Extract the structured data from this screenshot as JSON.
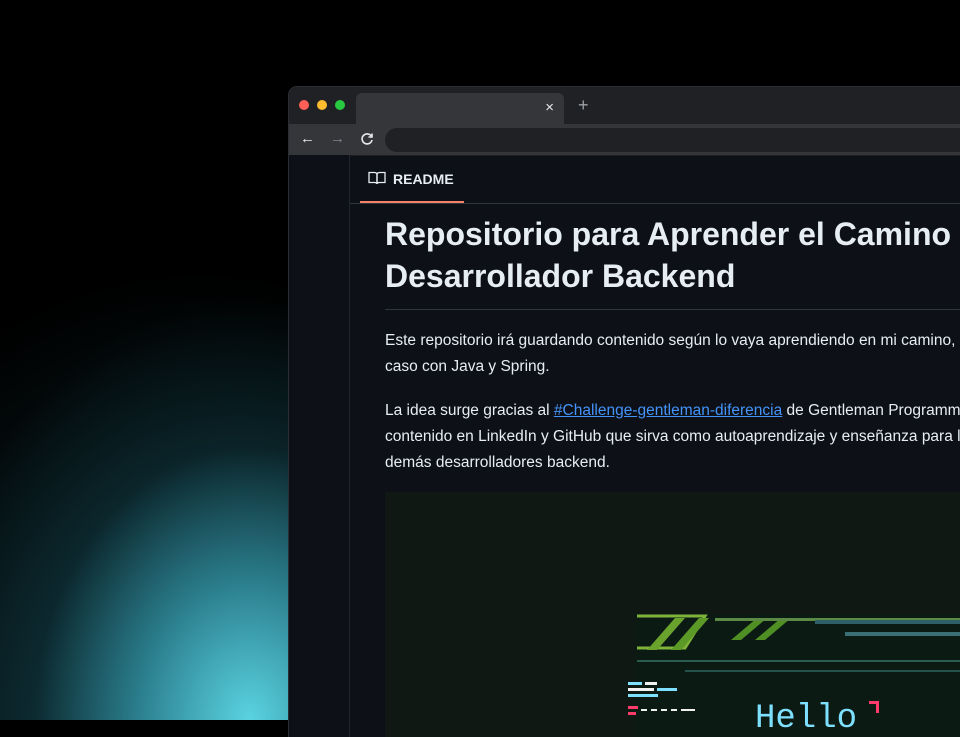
{
  "browser": {
    "tab_close": "×",
    "new_tab": "+",
    "back": "←",
    "forward": "→",
    "reload": "C"
  },
  "readme_tab": {
    "label": "README",
    "icon": "book-icon"
  },
  "article": {
    "title_line1": "Repositorio para Aprender el Camino de",
    "title_line2": "Desarrollador Backend",
    "para1_line1": "Este repositorio irá guardando contenido según lo vaya aprendiendo en mi camino, en este",
    "para1_line2": "caso con Java y Spring.",
    "para2_prefix": "La idea surge gracias al ",
    "para2_link": "#Challenge-gentleman-diferencia",
    "para2_suffix": " de Gentleman Programming, para generar",
    "para2_line2": "contenido en LinkedIn y GitHub que sirva como autoaprendizaje y enseñanza para los",
    "para2_line3": "demás desarrolladores backend."
  },
  "hero": {
    "text": "Hello"
  },
  "colors": {
    "accent_underline": "#f78166",
    "link": "#4493f8",
    "background": "#0d1117",
    "text": "#e6edf3"
  }
}
